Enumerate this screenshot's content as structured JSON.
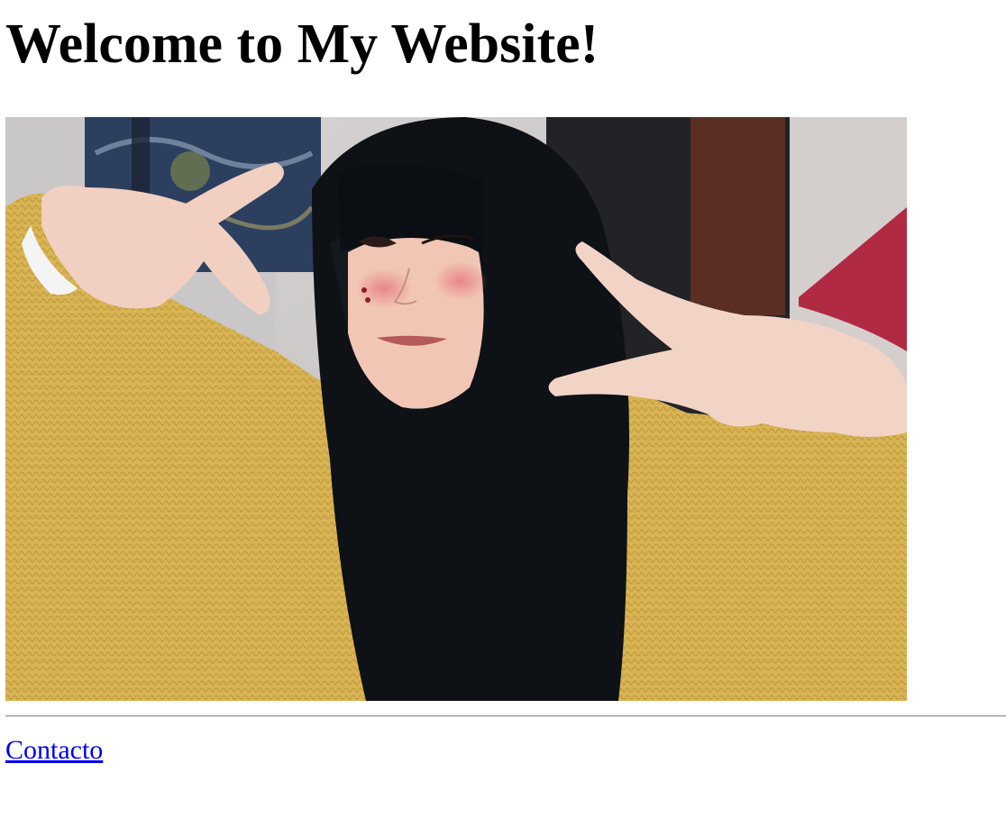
{
  "page": {
    "title": "Welcome to My Website!"
  },
  "photo": {
    "alt": "Person with long black hair in a mustard knit cardigan making peace signs"
  },
  "footer": {
    "link_label": "Contacto",
    "link_color": "#0000ee"
  },
  "colors": {
    "background": "#ffffff",
    "text": "#000000",
    "divider": "#9a9a9a"
  }
}
